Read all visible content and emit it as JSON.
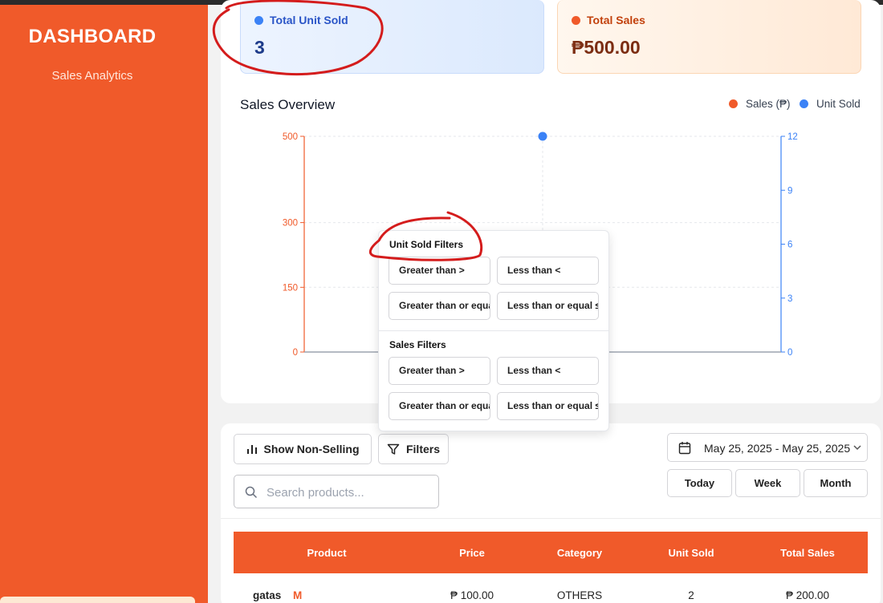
{
  "sidebar": {
    "title": "DASHBOARD",
    "subtitle": "Sales Analytics"
  },
  "cards": {
    "units": {
      "label": "Total Unit Sold",
      "value": "3"
    },
    "sales": {
      "label": "Total Sales",
      "value": "₱500.00"
    }
  },
  "chart": {
    "title": "Sales Overview",
    "legend": {
      "sales": "Sales (₱)",
      "units": "Unit Sold"
    },
    "left_ticks": [
      "500",
      "300",
      "150",
      "0"
    ],
    "right_ticks": [
      "12",
      "9",
      "6",
      "3",
      "0"
    ],
    "colors": {
      "sales": "#f05a2a",
      "units": "#3b82f6"
    }
  },
  "chart_data": {
    "type": "line",
    "title": "Sales Overview",
    "series": [
      {
        "name": "Sales (₱)",
        "axis": "left",
        "values": [
          0
        ]
      },
      {
        "name": "Unit Sold",
        "axis": "right",
        "values": [
          12
        ]
      }
    ],
    "ylim_left": [
      0,
      500
    ],
    "ylim_right": [
      0,
      12
    ],
    "grid": true,
    "legend_position": "top-right"
  },
  "filters_dropdown": {
    "unit_heading": "Unit Sold Filters",
    "sales_heading": "Sales Filters",
    "unit_options": [
      "Greater than >",
      "Less than <",
      "Greater than or equal ≥",
      "Less than or equal ≤"
    ],
    "sales_options": [
      "Greater than >",
      "Less than <",
      "Greater than or equal ≥",
      "Less than or equal ≤"
    ]
  },
  "controls": {
    "show_non_selling": "Show Non-Selling",
    "filters": "Filters",
    "search_placeholder": "Search products...",
    "date_range": "May 25, 2025 - May 25, 2025",
    "today": "Today",
    "week": "Week",
    "month": "Month"
  },
  "table": {
    "headers": [
      "Product",
      "Price",
      "Category",
      "Unit Sold",
      "Total Sales"
    ],
    "rows": [
      {
        "product": "gatas",
        "size": "M",
        "price": "₱ 100.00",
        "category": "OTHERS",
        "unit_sold": "2",
        "total_sales": "₱ 200.00"
      }
    ]
  }
}
